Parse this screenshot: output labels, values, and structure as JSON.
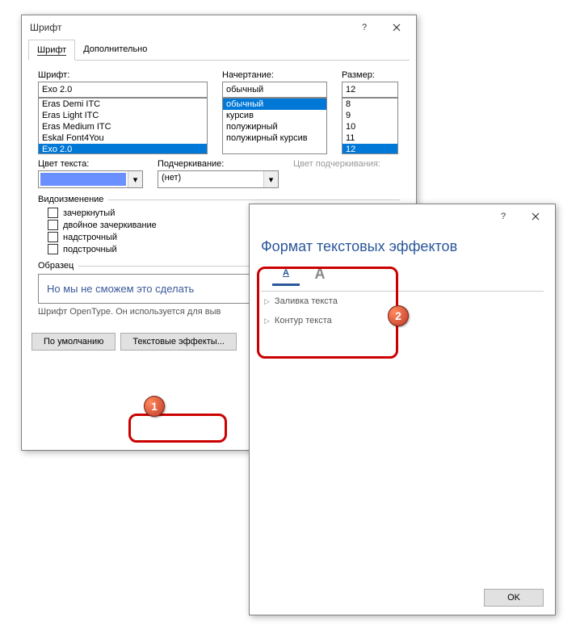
{
  "font_dialog": {
    "title": "Шрифт",
    "tabs": {
      "font": "Шрифт",
      "advanced": "Дополнительно"
    },
    "labels": {
      "font": "Шрифт:",
      "style": "Начертание:",
      "size": "Размер:",
      "font_color": "Цвет текста:",
      "underline": "Подчеркивание:",
      "underline_color": "Цвет подчеркивания:",
      "effects_group": "Видоизменение",
      "preview_group": "Образец"
    },
    "font_value": "Exo 2.0",
    "font_list": [
      "Eras Demi ITC",
      "Eras Light ITC",
      "Eras Medium ITC",
      "Eskal Font4You",
      "Exo 2.0"
    ],
    "font_selected": "Exo 2.0",
    "style_value": "обычный",
    "style_list": [
      "обычный",
      "курсив",
      "полужирный",
      "полужирный курсив"
    ],
    "style_selected": "обычный",
    "size_value": "12",
    "size_list": [
      "8",
      "9",
      "10",
      "11",
      "12"
    ],
    "size_selected": "12",
    "underline_value": "(нет)",
    "effects": {
      "strike": "зачеркнутый",
      "double_strike": "двойное зачеркивание",
      "superscript": "надстрочный",
      "subscript": "подстрочный"
    },
    "preview_text": "Но мы не сможем это сделать",
    "hint": "Шрифт OpenType. Он используется для выв",
    "buttons": {
      "default": "По умолчанию",
      "text_effects": "Текстовые эффекты..."
    }
  },
  "format_dialog": {
    "title": "Формат текстовых эффектов",
    "items": {
      "fill": "Заливка текста",
      "outline": "Контур текста"
    },
    "ok": "OK"
  },
  "callouts": {
    "one": "1",
    "two": "2"
  }
}
